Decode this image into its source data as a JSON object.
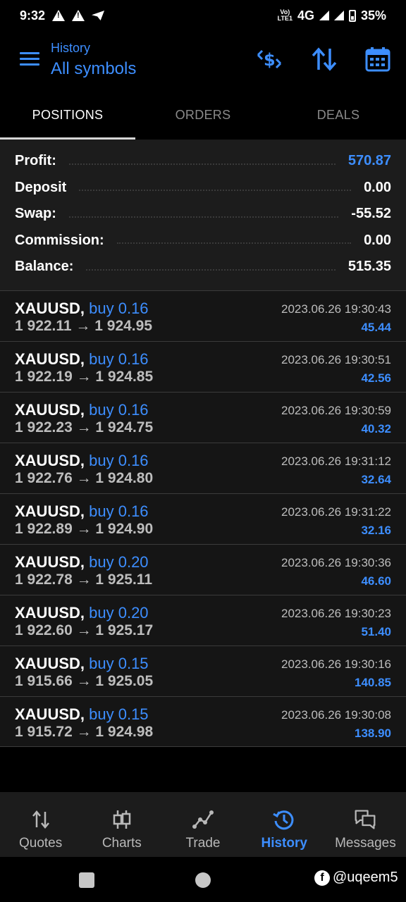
{
  "status_bar": {
    "time": "9:32",
    "network": "4G",
    "volte": "Vo)\nLTE1",
    "battery": "35%"
  },
  "header": {
    "subtitle": "History",
    "title": "All symbols"
  },
  "tabs": [
    {
      "label": "POSITIONS",
      "active": true
    },
    {
      "label": "ORDERS",
      "active": false
    },
    {
      "label": "DEALS",
      "active": false
    }
  ],
  "summary": {
    "profit_label": "Profit:",
    "profit_value": "570.87",
    "deposit_label": "Deposit",
    "deposit_value": "0.00",
    "swap_label": "Swap:",
    "swap_value": "-55.52",
    "commission_label": "Commission:",
    "commission_value": "0.00",
    "balance_label": "Balance:",
    "balance_value": "515.35"
  },
  "positions": [
    {
      "symbol": "XAUUSD,",
      "side": "buy 0.16",
      "prices": "1 922.11 → 1 924.95",
      "time": "2023.06.26 19:30:43",
      "profit": "45.44"
    },
    {
      "symbol": "XAUUSD,",
      "side": "buy 0.16",
      "prices": "1 922.19 → 1 924.85",
      "time": "2023.06.26 19:30:51",
      "profit": "42.56"
    },
    {
      "symbol": "XAUUSD,",
      "side": "buy 0.16",
      "prices": "1 922.23 → 1 924.75",
      "time": "2023.06.26 19:30:59",
      "profit": "40.32"
    },
    {
      "symbol": "XAUUSD,",
      "side": "buy 0.16",
      "prices": "1 922.76 → 1 924.80",
      "time": "2023.06.26 19:31:12",
      "profit": "32.64"
    },
    {
      "symbol": "XAUUSD,",
      "side": "buy 0.16",
      "prices": "1 922.89 → 1 924.90",
      "time": "2023.06.26 19:31:22",
      "profit": "32.16"
    },
    {
      "symbol": "XAUUSD,",
      "side": "buy 0.20",
      "prices": "1 922.78 → 1 925.11",
      "time": "2023.06.26 19:30:36",
      "profit": "46.60"
    },
    {
      "symbol": "XAUUSD,",
      "side": "buy 0.20",
      "prices": "1 922.60 → 1 925.17",
      "time": "2023.06.26 19:30:23",
      "profit": "51.40"
    },
    {
      "symbol": "XAUUSD,",
      "side": "buy 0.15",
      "prices": "1 915.66 → 1 925.05",
      "time": "2023.06.26 19:30:16",
      "profit": "140.85"
    },
    {
      "symbol": "XAUUSD,",
      "side": "buy 0.15",
      "prices": "1 915.72 → 1 924.98",
      "time": "2023.06.26 19:30:08",
      "profit": "138.90"
    }
  ],
  "bottom_nav": [
    {
      "label": "Quotes",
      "icon": "quotes-icon"
    },
    {
      "label": "Charts",
      "icon": "charts-icon"
    },
    {
      "label": "Trade",
      "icon": "trade-icon"
    },
    {
      "label": "History",
      "icon": "history-icon",
      "active": true
    },
    {
      "label": "Messages",
      "icon": "messages-icon"
    }
  ],
  "watermark": {
    "text": "@uqeem5"
  },
  "colors": {
    "accent": "#3d8eff",
    "background": "#000000",
    "panel": "#1c1c1c",
    "list": "#151515"
  }
}
